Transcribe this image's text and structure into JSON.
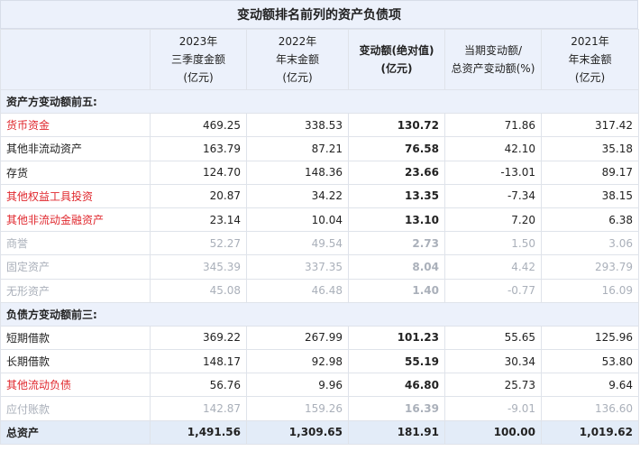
{
  "title": "变动额排名前列的资产负债项",
  "header": {
    "col1": "",
    "col2": [
      "2023年",
      "三季度金额",
      "(亿元)"
    ],
    "col3": [
      "2022年",
      "年末金额",
      "(亿元)"
    ],
    "col4": [
      "变动额(绝对值)",
      "(亿元)"
    ],
    "col5": [
      "当期变动额/",
      "总资产变动额(%)"
    ],
    "col6": [
      "2021年",
      "年末金额",
      "(亿元)"
    ]
  },
  "sections": {
    "assets": "资产方变动额前五:",
    "liabilities": "负债方变动额前三:"
  },
  "asset_rows": [
    {
      "name": "货币资金",
      "style": "red",
      "v2023": "469.25",
      "v2022": "338.53",
      "change": "130.72",
      "ratio": "71.86",
      "v2021": "317.42"
    },
    {
      "name": "其他非流动资产",
      "style": "normal",
      "v2023": "163.79",
      "v2022": "87.21",
      "change": "76.58",
      "ratio": "42.10",
      "v2021": "35.18"
    },
    {
      "name": "存货",
      "style": "normal",
      "v2023": "124.70",
      "v2022": "148.36",
      "change": "23.66",
      "ratio": "-13.01",
      "v2021": "89.17"
    },
    {
      "name": "其他权益工具投资",
      "style": "red",
      "v2023": "20.87",
      "v2022": "34.22",
      "change": "13.35",
      "ratio": "-7.34",
      "v2021": "38.15"
    },
    {
      "name": "其他非流动金融资产",
      "style": "red",
      "v2023": "23.14",
      "v2022": "10.04",
      "change": "13.10",
      "ratio": "7.20",
      "v2021": "6.38"
    },
    {
      "name": "商誉",
      "style": "muted",
      "v2023": "52.27",
      "v2022": "49.54",
      "change": "2.73",
      "ratio": "1.50",
      "v2021": "3.06"
    },
    {
      "name": "固定资产",
      "style": "muted",
      "v2023": "345.39",
      "v2022": "337.35",
      "change": "8.04",
      "ratio": "4.42",
      "v2021": "293.79"
    },
    {
      "name": "无形资产",
      "style": "muted",
      "v2023": "45.08",
      "v2022": "46.48",
      "change": "1.40",
      "ratio": "-0.77",
      "v2021": "16.09"
    }
  ],
  "liability_rows": [
    {
      "name": "短期借款",
      "style": "normal",
      "v2023": "369.22",
      "v2022": "267.99",
      "change": "101.23",
      "ratio": "55.65",
      "v2021": "125.96"
    },
    {
      "name": "长期借款",
      "style": "normal",
      "v2023": "148.17",
      "v2022": "92.98",
      "change": "55.19",
      "ratio": "30.34",
      "v2021": "53.80"
    },
    {
      "name": "其他流动负债",
      "style": "red",
      "v2023": "56.76",
      "v2022": "9.96",
      "change": "46.80",
      "ratio": "25.73",
      "v2021": "9.64"
    },
    {
      "name": "应付账款",
      "style": "muted",
      "v2023": "142.87",
      "v2022": "159.26",
      "change": "16.39",
      "ratio": "-9.01",
      "v2021": "136.60"
    }
  ],
  "total_row": {
    "name": "总资产",
    "v2023": "1,491.56",
    "v2022": "1,309.65",
    "change": "181.91",
    "ratio": "100.00",
    "v2021": "1,019.62"
  },
  "colors": {
    "red": "#e0282e",
    "header_bg": "#ecf1fb",
    "muted": "#aab0ba"
  }
}
